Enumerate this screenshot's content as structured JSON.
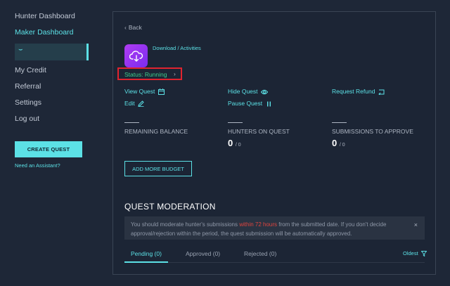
{
  "sidebar": {
    "items": [
      {
        "label": "Hunter Dashboard"
      },
      {
        "label": "Maker Dashboard"
      },
      {
        "label": "My Credit"
      },
      {
        "label": "Referral"
      },
      {
        "label": "Settings"
      },
      {
        "label": "Log out"
      }
    ],
    "selected_glyph": "⌣",
    "create_quest_label": "CREATE QUEST",
    "assistant_link": "Need an Assistant?"
  },
  "quest": {
    "back_label": "Back",
    "breadcrumb": "Download / Activities",
    "status": "Status: Running",
    "actions": {
      "view": "View Quest",
      "hide": "Hide Quest",
      "refund": "Request Refund",
      "edit": "Edit",
      "pause": "Pause Quest"
    },
    "stats": [
      {
        "label": "REMAINING BALANCE",
        "value": "",
        "total": ""
      },
      {
        "label": "HUNTERS ON QUEST",
        "value": "0",
        "total": "/ 0"
      },
      {
        "label": "SUBMISSIONS TO APPROVE",
        "value": "0",
        "total": "/ 0"
      }
    ],
    "add_budget_label": "ADD MORE BUDGET"
  },
  "moderation": {
    "title": "QUEST MODERATION",
    "notice_before": "You should moderate hunter's submissions ",
    "notice_highlight": "within 72 hours",
    "notice_after": " from the submitted date. If you don't decide approval/rejection within the period, the quest submission will be automatically approved.",
    "close_glyph": "×",
    "tabs": [
      {
        "label": "Pending (0)"
      },
      {
        "label": "Approved (0)"
      },
      {
        "label": "Rejected (0)"
      }
    ],
    "sort_label": "Oldest"
  },
  "colors": {
    "accent": "#5ce1e6",
    "status_running": "#3ecf8e",
    "highlight_red": "#e0443e",
    "background": "#1e2737"
  }
}
